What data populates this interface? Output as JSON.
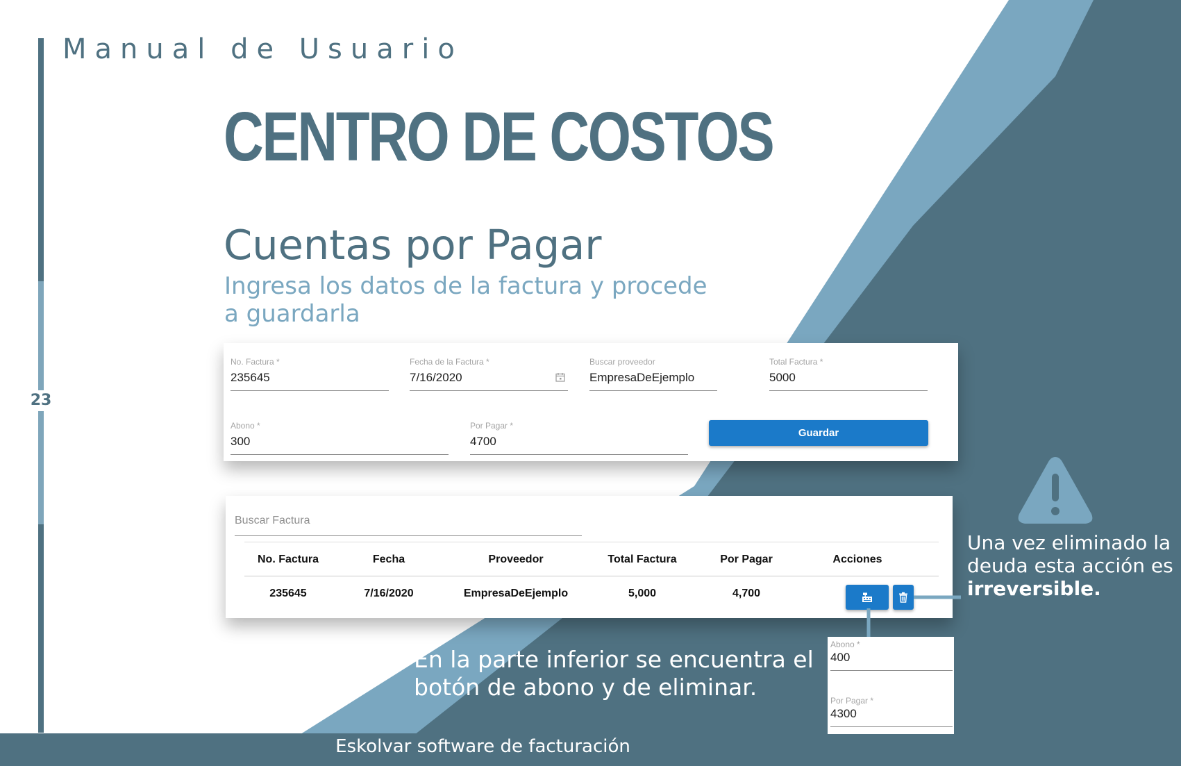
{
  "header": {
    "manual_title": "Manual de Usuario",
    "section_title": "CENTRO DE COSTOS",
    "page_number": "23"
  },
  "page": {
    "heading": "Cuentas por Pagar",
    "subheading": "Ingresa los datos de la factura y procede a guardarla"
  },
  "invoice_form": {
    "invoice_number": {
      "label": "No. Factura *",
      "value": "235645"
    },
    "invoice_date": {
      "label": "Fecha de la Factura *",
      "value": "7/16/2020"
    },
    "supplier_search": {
      "label": "Buscar proveedor",
      "value": "EmpresaDeEjemplo"
    },
    "invoice_total": {
      "label": "Total Factura *",
      "value": "5000"
    },
    "payment": {
      "label": "Abono *",
      "value": "300"
    },
    "balance_due": {
      "label": "Por Pagar *",
      "value": "4700"
    },
    "save_label": "Guardar"
  },
  "invoice_table": {
    "search_placeholder": "Buscar Factura",
    "columns": [
      "No. Factura",
      "Fecha",
      "Proveedor",
      "Total Factura",
      "Por Pagar",
      "Acciones"
    ],
    "rows": [
      {
        "invoice_number": "235645",
        "date": "7/16/2020",
        "supplier": "EmpresaDeEjemplo",
        "total": "5,000",
        "balance": "4,700"
      }
    ],
    "actions": {
      "payment_icon": "cash-register-icon",
      "delete_icon": "trash-icon"
    }
  },
  "callout_form": {
    "payment": {
      "label": "Abono *",
      "value": "400"
    },
    "balance_due": {
      "label": "Por Pagar *",
      "value": "4300"
    }
  },
  "notes": {
    "warning_text": "Una vez eliminado la deuda esta acción es",
    "warning_emphasis": "irreversible.",
    "bottom_note": "En la parte inferior se encuentra el botón de abono y de eliminar."
  },
  "footer": {
    "text": "Eskolvar software de facturación"
  },
  "colors": {
    "primary_dark": "#4f7181",
    "light_blue": "#7aa7c0",
    "button_blue": "#1b7ac9"
  }
}
